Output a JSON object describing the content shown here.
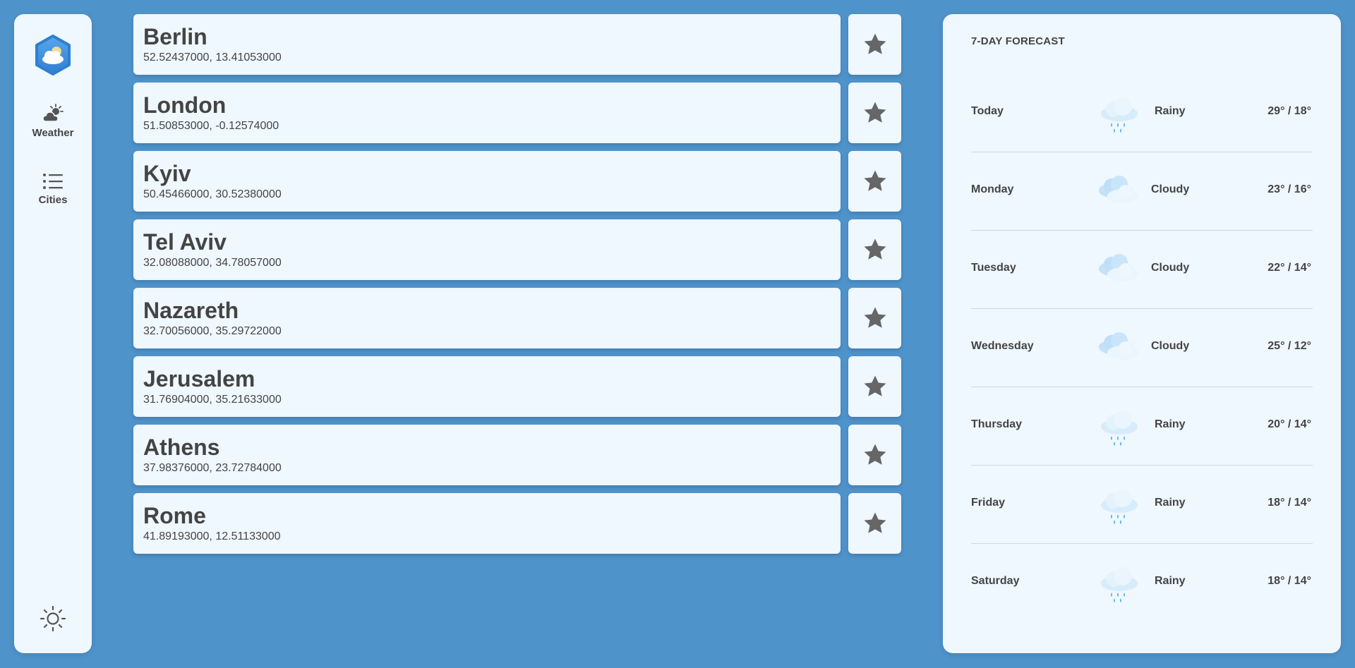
{
  "sidebar": {
    "logo_icon": "weather-app-logo-icon",
    "items": [
      {
        "label": "Weather",
        "icon": "partly-cloudy-icon"
      },
      {
        "label": "Cities",
        "icon": "list-icon"
      }
    ],
    "theme_icon": "sun-icon"
  },
  "cities": [
    {
      "name": "Berlin",
      "coords": "52.52437000, 13.41053000"
    },
    {
      "name": "London",
      "coords": "51.50853000, -0.12574000"
    },
    {
      "name": "Kyiv",
      "coords": "50.45466000, 30.52380000"
    },
    {
      "name": "Tel Aviv",
      "coords": "32.08088000, 34.78057000"
    },
    {
      "name": "Nazareth",
      "coords": "32.70056000, 35.29722000"
    },
    {
      "name": "Jerusalem",
      "coords": "31.76904000, 35.21633000"
    },
    {
      "name": "Athens",
      "coords": "37.98376000, 23.72784000"
    },
    {
      "name": "Rome",
      "coords": "41.89193000, 12.51133000"
    }
  ],
  "favorite_icon": "star-icon",
  "forecast": {
    "title": "7-DAY FORECAST",
    "days": [
      {
        "day": "Today",
        "condition": "Rainy",
        "icon": "rain-icon",
        "temp": "29° / 18°"
      },
      {
        "day": "Monday",
        "condition": "Cloudy",
        "icon": "cloud-icon",
        "temp": "23° / 16°"
      },
      {
        "day": "Tuesday",
        "condition": "Cloudy",
        "icon": "cloud-icon",
        "temp": "22° / 14°"
      },
      {
        "day": "Wednesday",
        "condition": "Cloudy",
        "icon": "cloud-icon",
        "temp": "25° / 12°"
      },
      {
        "day": "Thursday",
        "condition": "Rainy",
        "icon": "rain-icon",
        "temp": "20° / 14°"
      },
      {
        "day": "Friday",
        "condition": "Rainy",
        "icon": "rain-icon",
        "temp": "18° / 14°"
      },
      {
        "day": "Saturday",
        "condition": "Rainy",
        "icon": "rain-icon",
        "temp": "18° / 14°"
      }
    ]
  },
  "colors": {
    "background": "#4f93cb",
    "panel": "#eff7ff",
    "text": "#444444",
    "star": "#666666",
    "logo": "#3a8ad6"
  }
}
